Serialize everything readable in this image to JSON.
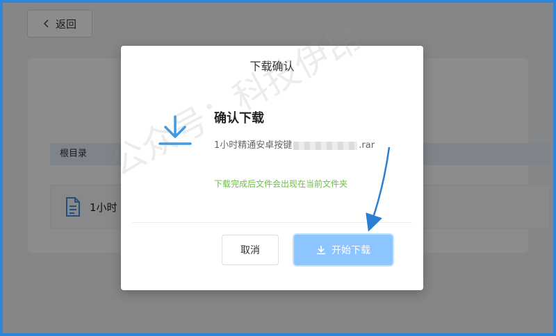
{
  "background": {
    "back_label": "返回",
    "breadcrumb": "根目录",
    "file_row_name": "1小时"
  },
  "dialog": {
    "title": "下载确认",
    "heading": "确认下载",
    "file_name_start": "1小时精通安卓按键",
    "file_name_end": ".rar",
    "hint": "下载完成后文件会出现在当前文件夹",
    "cancel_label": "取消",
    "start_label": "开始下载"
  },
  "watermark": "公众号：科技伊昂",
  "colors": {
    "primary": "#409eff",
    "primary_disabled": "#8cc5ff",
    "success": "#67c23a",
    "frame_border": "#2f84dc"
  },
  "icons": {
    "back": "chevron-left-icon",
    "file": "document-icon",
    "download_large": "download-icon",
    "download_small": "download-icon"
  }
}
